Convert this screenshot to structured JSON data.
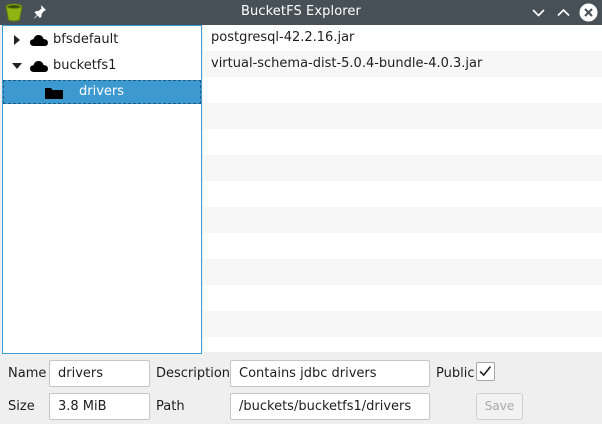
{
  "window": {
    "title": "BucketFS Explorer",
    "app_icon": "bucket-icon",
    "pin_icon": "pin-icon",
    "controls": [
      "minimize-icon",
      "maximize-icon",
      "close-icon"
    ]
  },
  "tree": {
    "items": [
      {
        "label": "bfsdefault",
        "icon": "cloud-icon",
        "expanded": false,
        "level": 0
      },
      {
        "label": "bucketfs1",
        "icon": "cloud-icon",
        "expanded": true,
        "level": 0
      },
      {
        "label": "drivers",
        "icon": "folder-icon",
        "selected": true,
        "level": 1
      }
    ]
  },
  "files": {
    "items": [
      "postgresql-42.2.16.jar",
      "virtual-schema-dist-5.0.4-bundle-4.0.3.jar"
    ]
  },
  "form": {
    "name_label": "Name",
    "name_value": "drivers",
    "description_label": "Description",
    "description_value": "Contains jdbc drivers",
    "public_label": "Public",
    "public_checked": true,
    "size_label": "Size",
    "size_value": "3.8 MiB",
    "path_label": "Path",
    "path_value": "/buckets/bucketfs1/drivers",
    "save_label": "Save"
  },
  "colors": {
    "titlebar": "#475057",
    "selection": "#3d9ad0",
    "tree_border": "#3d9dd6"
  }
}
